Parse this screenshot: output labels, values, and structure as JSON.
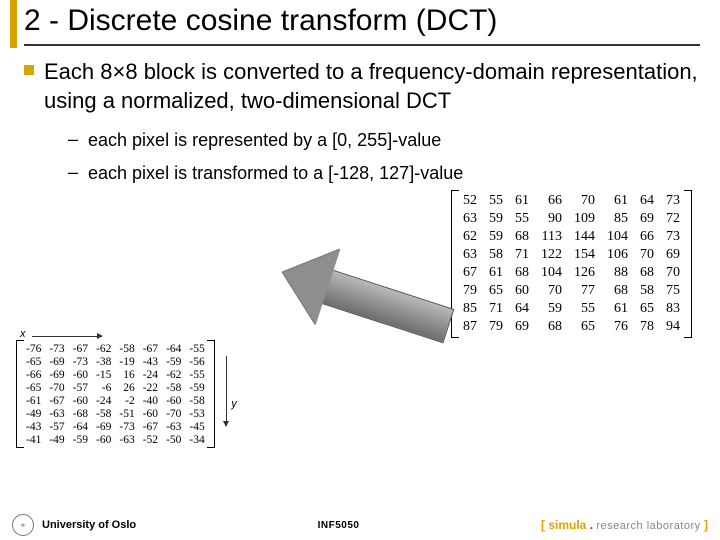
{
  "title": "2 - Discrete cosine transform (DCT)",
  "bullet": "Each 8×8 block is converted to a frequency-domain representation, using a normalized, two-dimensional DCT",
  "sub1": "each pixel is represented by a [0, 255]-value",
  "sub2": "each pixel is transformed to a [-128, 127]-value",
  "matrix_original": [
    [
      "52",
      "55",
      "61",
      "66",
      "70",
      "61",
      "64",
      "73"
    ],
    [
      "63",
      "59",
      "55",
      "90",
      "109",
      "85",
      "69",
      "72"
    ],
    [
      "62",
      "59",
      "68",
      "113",
      "144",
      "104",
      "66",
      "73"
    ],
    [
      "63",
      "58",
      "71",
      "122",
      "154",
      "106",
      "70",
      "69"
    ],
    [
      "67",
      "61",
      "68",
      "104",
      "126",
      "88",
      "68",
      "70"
    ],
    [
      "79",
      "65",
      "60",
      "70",
      "77",
      "68",
      "58",
      "75"
    ],
    [
      "85",
      "71",
      "64",
      "59",
      "55",
      "61",
      "65",
      "83"
    ],
    [
      "87",
      "79",
      "69",
      "68",
      "65",
      "76",
      "78",
      "94"
    ]
  ],
  "matrix_shifted": [
    [
      "-76",
      "-73",
      "-67",
      "-62",
      "-58",
      "-67",
      "-64",
      "-55"
    ],
    [
      "-65",
      "-69",
      "-73",
      "-38",
      "-19",
      "-43",
      "-59",
      "-56"
    ],
    [
      "-66",
      "-69",
      "-60",
      "-15",
      "16",
      "-24",
      "-62",
      "-55"
    ],
    [
      "-65",
      "-70",
      "-57",
      "-6",
      "26",
      "-22",
      "-58",
      "-59"
    ],
    [
      "-61",
      "-67",
      "-60",
      "-24",
      "-2",
      "-40",
      "-60",
      "-58"
    ],
    [
      "-49",
      "-63",
      "-68",
      "-58",
      "-51",
      "-60",
      "-70",
      "-53"
    ],
    [
      "-43",
      "-57",
      "-64",
      "-69",
      "-73",
      "-67",
      "-63",
      "-45"
    ],
    [
      "-41",
      "-49",
      "-59",
      "-60",
      "-63",
      "-52",
      "-50",
      "-34"
    ]
  ],
  "axes": {
    "x": "x",
    "y": "y"
  },
  "footer": {
    "uio": "University of Oslo",
    "course": "INF5050",
    "simula_bracket_l": "[ ",
    "simula_name": "simula",
    "simula_dot": " . ",
    "simula_lab": "research laboratory",
    "simula_bracket_r": " ]"
  }
}
